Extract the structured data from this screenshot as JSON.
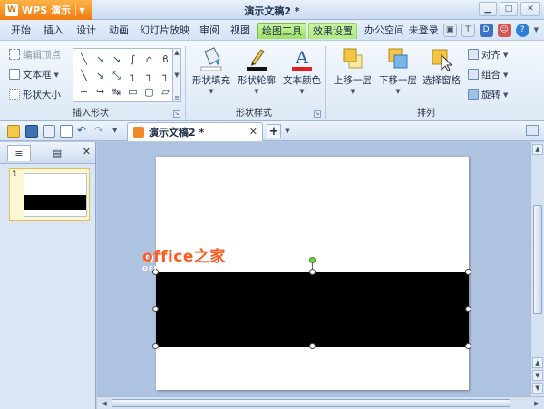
{
  "titlebar": {
    "app_button": "WPS 演示",
    "doc_title": "演示文稿2 *"
  },
  "menu": {
    "tabs": [
      "开始",
      "插入",
      "设计",
      "动画",
      "幻灯片放映",
      "审阅",
      "视图",
      "绘图工具",
      "效果设置",
      "办公空间"
    ],
    "login": "未登录"
  },
  "ribbon": {
    "insert_shapes": {
      "edit_vertex": "编辑顶点",
      "text_box": "文本框",
      "shape_size": "形状大小",
      "group_label": "插入形状"
    },
    "shape_style": {
      "fill": "形状填充",
      "outline": "形状轮廓",
      "text_color": "文本颜色",
      "group_label": "形状样式"
    },
    "arrange": {
      "bring_forward": "上移一层",
      "send_backward": "下移一层",
      "selection_pane": "选择窗格",
      "align": "对齐",
      "group": "组合",
      "rotate": "旋转",
      "group_label": "排列"
    }
  },
  "toolbar": {
    "doc_tab": "演示文稿2 *"
  },
  "slides_pane": {
    "slide_number": "1"
  },
  "watermark": {
    "main": "office之家",
    "sub": "OFFICEJB51.NET"
  },
  "colors": {
    "active_tab": "#9ee062",
    "wps_orange": "#ef7b12",
    "slide_shape": "#000000"
  }
}
